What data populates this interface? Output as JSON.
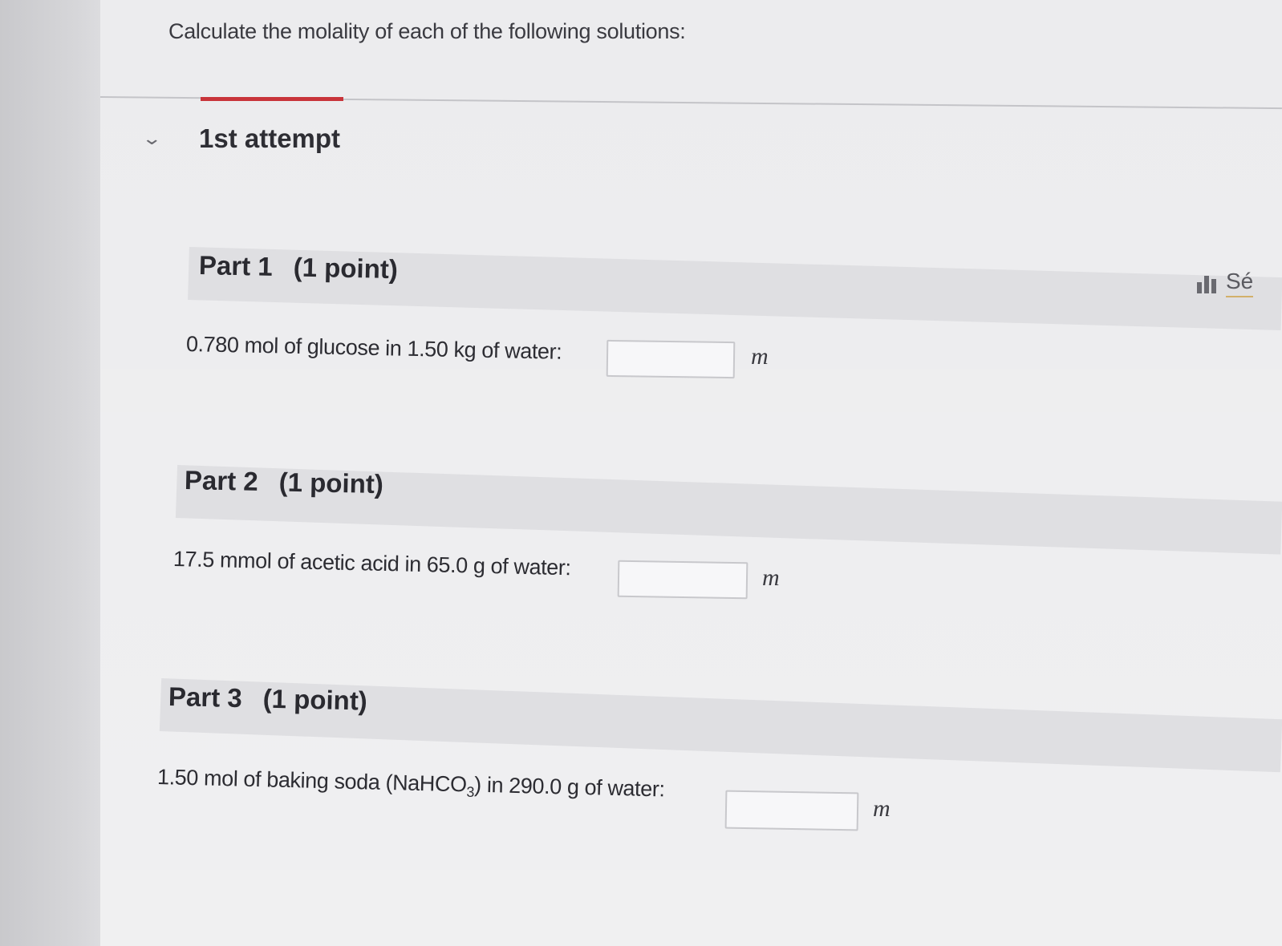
{
  "question": {
    "text": "Calculate the molality of each of the following solutions:"
  },
  "attempt": {
    "label": "1st attempt",
    "accent_color": "#c8343a"
  },
  "side_tool": {
    "label": "Sé",
    "icon": "bar-chart-icon"
  },
  "parts": [
    {
      "title": "Part 1",
      "points": "(1 point)",
      "prompt": "0.780  mol of glucose in 1.50 kg of water:",
      "answer_value": "",
      "unit": "m"
    },
    {
      "title": "Part 2",
      "points": "(1 point)",
      "prompt": "17.5  mmol of acetic acid in 65.0 g of water:",
      "answer_value": "",
      "unit": "m"
    },
    {
      "title": "Part 3",
      "points": "(1 point)",
      "prompt_before": "1.50  mol of baking soda (NaHCO",
      "prompt_sub": "3",
      "prompt_after": ") in 290.0 g of water:",
      "answer_value": "",
      "unit": "m"
    }
  ]
}
